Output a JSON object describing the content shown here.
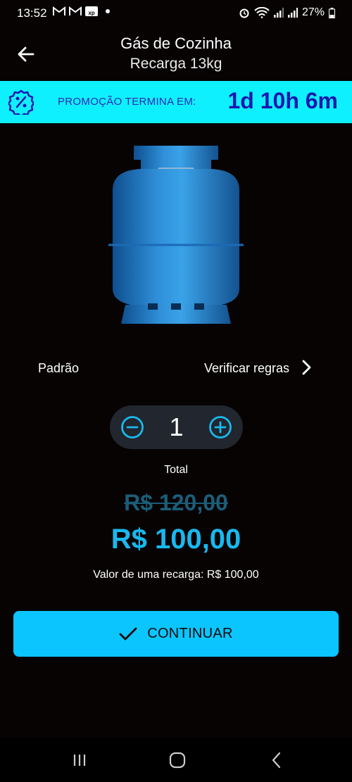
{
  "status_bar": {
    "time": "13:52",
    "battery": "27%",
    "left_icons": [
      "gmail-icon",
      "gmail-icon",
      "xp-icon",
      "dot-icon"
    ],
    "right_icons": [
      "alarm-icon",
      "wifi-icon",
      "signal-icon",
      "signal-icon",
      "battery-icon"
    ]
  },
  "header": {
    "title": "Gás de Cozinha",
    "subtitle": "Recarga 13kg",
    "back_icon": "arrow-left-icon"
  },
  "promo": {
    "label": "PROMOÇÃO TERMINA EM:",
    "timer": "1d 10h 6m",
    "icon": "percent-badge-icon",
    "background": "#0ff0ff",
    "text_color": "#1b17b0"
  },
  "product": {
    "image": "gas-cylinder",
    "variant": "Padrão",
    "rules_link": "Verificar regras"
  },
  "quantity": {
    "value": "1",
    "minus_icon": "minus-circle-icon",
    "plus_icon": "plus-circle-icon"
  },
  "pricing": {
    "total_label": "Total",
    "old_price": "R$ 120,00",
    "new_price": "R$ 100,00",
    "unit_price": "Valor de uma recarga: R$ 100,00",
    "accent": "#19b8ee"
  },
  "cta": {
    "label": "CONTINUAR",
    "icon": "check-icon",
    "background": "#0bc5ff"
  },
  "nav_bar": {
    "buttons": [
      "recent-apps-icon",
      "home-icon",
      "back-icon"
    ]
  }
}
